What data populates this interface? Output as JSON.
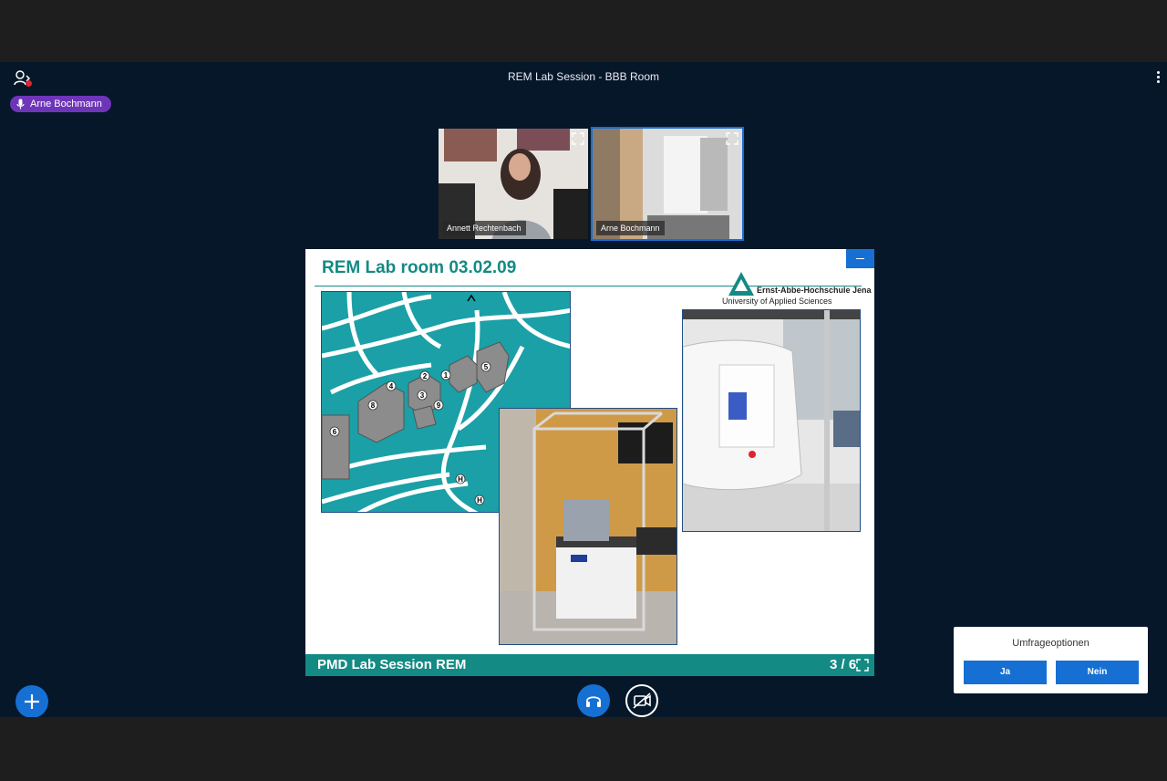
{
  "header": {
    "title": "REM Lab Session - BBB Room"
  },
  "talking_indicator": {
    "name": "Arne Bochmann"
  },
  "videos": [
    {
      "name": "Annett Rechtenbach"
    },
    {
      "name": "Arne Bochmann"
    }
  ],
  "slide": {
    "title": "REM Lab room 03.02.09",
    "logo_line1": "Ernst-Abbe-Hochschule Jena",
    "logo_line2": "University of Applied Sciences",
    "footer_title": "PMD Lab Session REM",
    "page": "3 / 6"
  },
  "poll": {
    "title": "Umfrageoptionen",
    "options": [
      "Ja",
      "Nein"
    ]
  },
  "colors": {
    "accent": "#1670d3",
    "background": "#06172a",
    "talker_badge": "#6e35b9",
    "slide_teal": "#148a84"
  }
}
